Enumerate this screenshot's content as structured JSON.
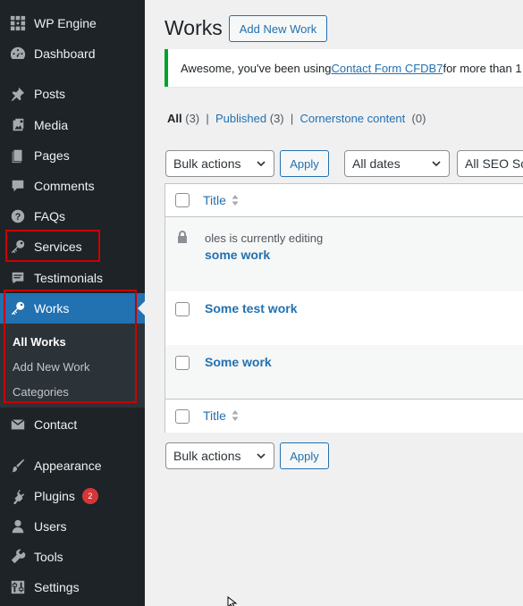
{
  "sidebar": {
    "items": [
      {
        "id": "wpengine",
        "label": "WP Engine",
        "icon": "wpengine-icon"
      },
      {
        "id": "dashboard",
        "label": "Dashboard",
        "icon": "dashboard-icon"
      },
      {
        "id": "posts",
        "label": "Posts",
        "icon": "pin-icon"
      },
      {
        "id": "media",
        "label": "Media",
        "icon": "media-icon"
      },
      {
        "id": "pages",
        "label": "Pages",
        "icon": "pages-icon"
      },
      {
        "id": "comments",
        "label": "Comments",
        "icon": "comment-icon"
      },
      {
        "id": "faqs",
        "label": "FAQs",
        "icon": "help-icon"
      },
      {
        "id": "services",
        "label": "Services",
        "icon": "key-icon"
      },
      {
        "id": "testimonials",
        "label": "Testimonials",
        "icon": "testimonial-icon"
      },
      {
        "id": "works",
        "label": "Works",
        "icon": "key-icon"
      },
      {
        "id": "contact",
        "label": "Contact",
        "icon": "mail-icon"
      },
      {
        "id": "appearance",
        "label": "Appearance",
        "icon": "brush-icon"
      },
      {
        "id": "plugins",
        "label": "Plugins",
        "icon": "plugin-icon",
        "badge": "2"
      },
      {
        "id": "users",
        "label": "Users",
        "icon": "user-icon"
      },
      {
        "id": "tools",
        "label": "Tools",
        "icon": "wrench-icon"
      },
      {
        "id": "settings",
        "label": "Settings",
        "icon": "settings-icon"
      }
    ],
    "submenu": [
      "All Works",
      "Add New Work",
      "Categories"
    ]
  },
  "header": {
    "title": "Works",
    "add_new_label": "Add New Work"
  },
  "notice": {
    "prefix": "Awesome, you've been using ",
    "link": "Contact Form CFDB7",
    "suffix": " for more than 1"
  },
  "filters": {
    "all_label": "All",
    "all_count": "(3)",
    "sep": "|",
    "published_label": "Published",
    "published_count": "(3)",
    "cornerstone_label": "Cornerstone content",
    "cornerstone_count": "(0)"
  },
  "toolbar": {
    "bulk_actions": "Bulk actions",
    "apply": "Apply",
    "all_dates": "All dates",
    "seo_scores": "All SEO Sco"
  },
  "table": {
    "column_title": "Title",
    "editing_notice": "oles is currently editing",
    "rows": [
      "some work",
      "Some test work",
      "Some work"
    ]
  },
  "colors": {
    "sidebar_bg": "#1d2327",
    "accent": "#2271b1",
    "notice_green": "#00a32a",
    "highlight_red": "#cc0000"
  }
}
